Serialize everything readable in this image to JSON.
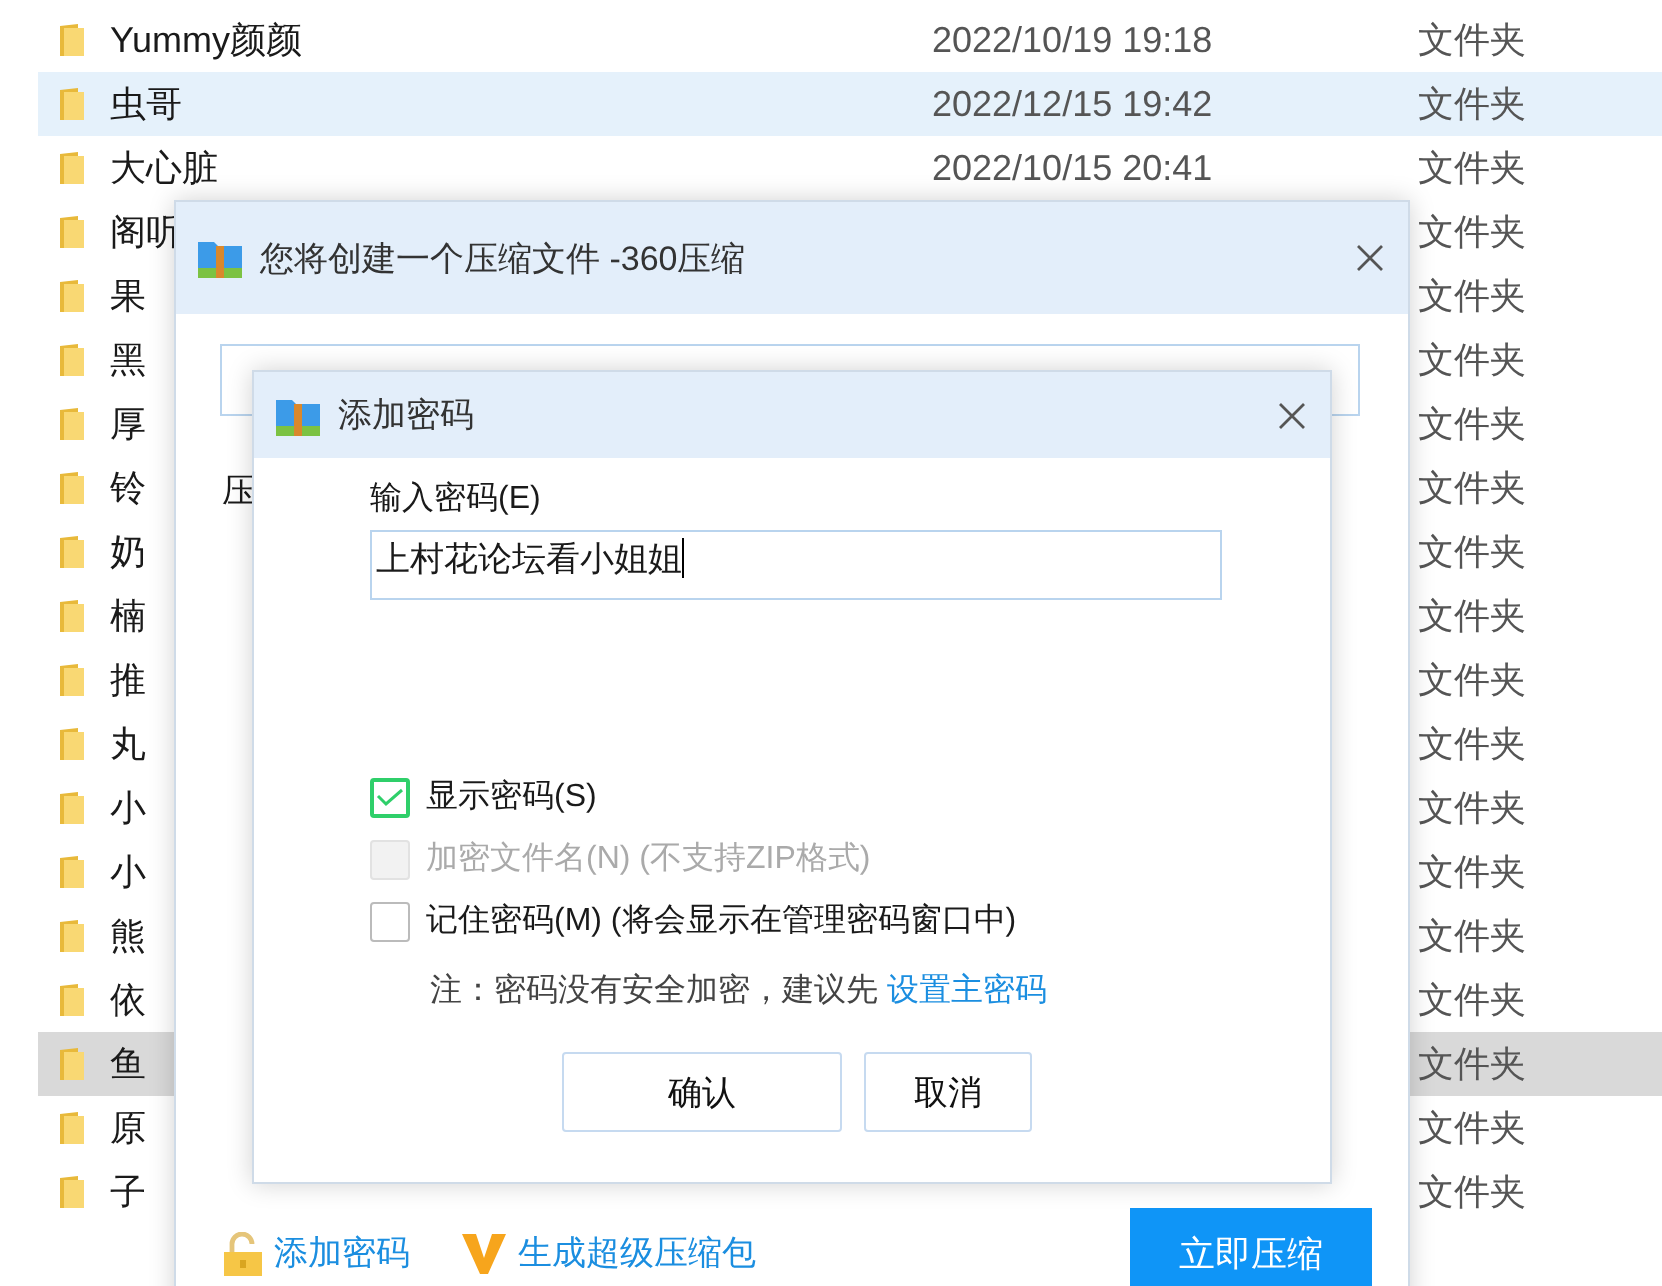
{
  "file_list": {
    "rows": [
      {
        "name": "Yummy颜颜",
        "date": "2022/10/19 19:18",
        "type": "文件夹",
        "selected": false,
        "hover": false
      },
      {
        "name": "虫哥",
        "date": "2022/12/15 19:42",
        "type": "文件夹",
        "selected": true,
        "hover": false
      },
      {
        "name": "大心脏",
        "date": "2022/10/15 20:41",
        "type": "文件夹",
        "selected": false,
        "hover": false
      },
      {
        "name": "阁听",
        "type": "文件夹",
        "selected": false,
        "hover": false
      },
      {
        "name": "果",
        "type": "文件夹",
        "selected": false,
        "hover": false
      },
      {
        "name": "黑",
        "type": "文件夹",
        "selected": false,
        "hover": false
      },
      {
        "name": "厚",
        "type": "文件夹",
        "selected": false,
        "hover": false
      },
      {
        "name": "铃",
        "type": "文件夹",
        "selected": false,
        "hover": false
      },
      {
        "name": "奶",
        "type": "文件夹",
        "selected": false,
        "hover": false
      },
      {
        "name": "楠",
        "type": "文件夹",
        "selected": false,
        "hover": false
      },
      {
        "name": "推",
        "type": "文件夹",
        "selected": false,
        "hover": false
      },
      {
        "name": "丸",
        "type": "文件夹",
        "selected": false,
        "hover": false
      },
      {
        "name": "小",
        "type": "文件夹",
        "selected": false,
        "hover": false
      },
      {
        "name": "小",
        "type": "文件夹",
        "selected": false,
        "hover": false
      },
      {
        "name": "熊",
        "type": "文件夹",
        "selected": false,
        "hover": false
      },
      {
        "name": "依",
        "type": "文件夹",
        "selected": false,
        "hover": false
      },
      {
        "name": "鱼",
        "type": "文件夹",
        "selected": false,
        "hover": true
      },
      {
        "name": "原",
        "type": "文件夹",
        "selected": false,
        "hover": false
      },
      {
        "name": "子",
        "type": "文件夹",
        "selected": false,
        "hover": false
      }
    ]
  },
  "compress_dialog": {
    "title": "您将创建一个压缩文件 -360压缩",
    "label": "压",
    "bottom_links": [
      {
        "kind": "lock",
        "label": "添加密码"
      },
      {
        "kind": "v",
        "label": "生成超级压缩包"
      }
    ],
    "primary_button": "立即压缩"
  },
  "password_dialog": {
    "title": "添加密码",
    "field_label": "输入密码(E)",
    "password": {
      "value": "上村花论坛看小姐姐"
    },
    "options": [
      {
        "label": "显示密码(S)",
        "checked": true,
        "disabled": false
      },
      {
        "label": "加密文件名(N) (不支持ZIP格式)",
        "checked": false,
        "disabled": true
      },
      {
        "label": "记住密码(M) (将会显示在管理密码窗口中)",
        "checked": false,
        "disabled": false
      }
    ],
    "note": "注：密码没有安全加密，建议先",
    "note_link": "设置主密码",
    "buttons": [
      "确认",
      "取消"
    ]
  }
}
